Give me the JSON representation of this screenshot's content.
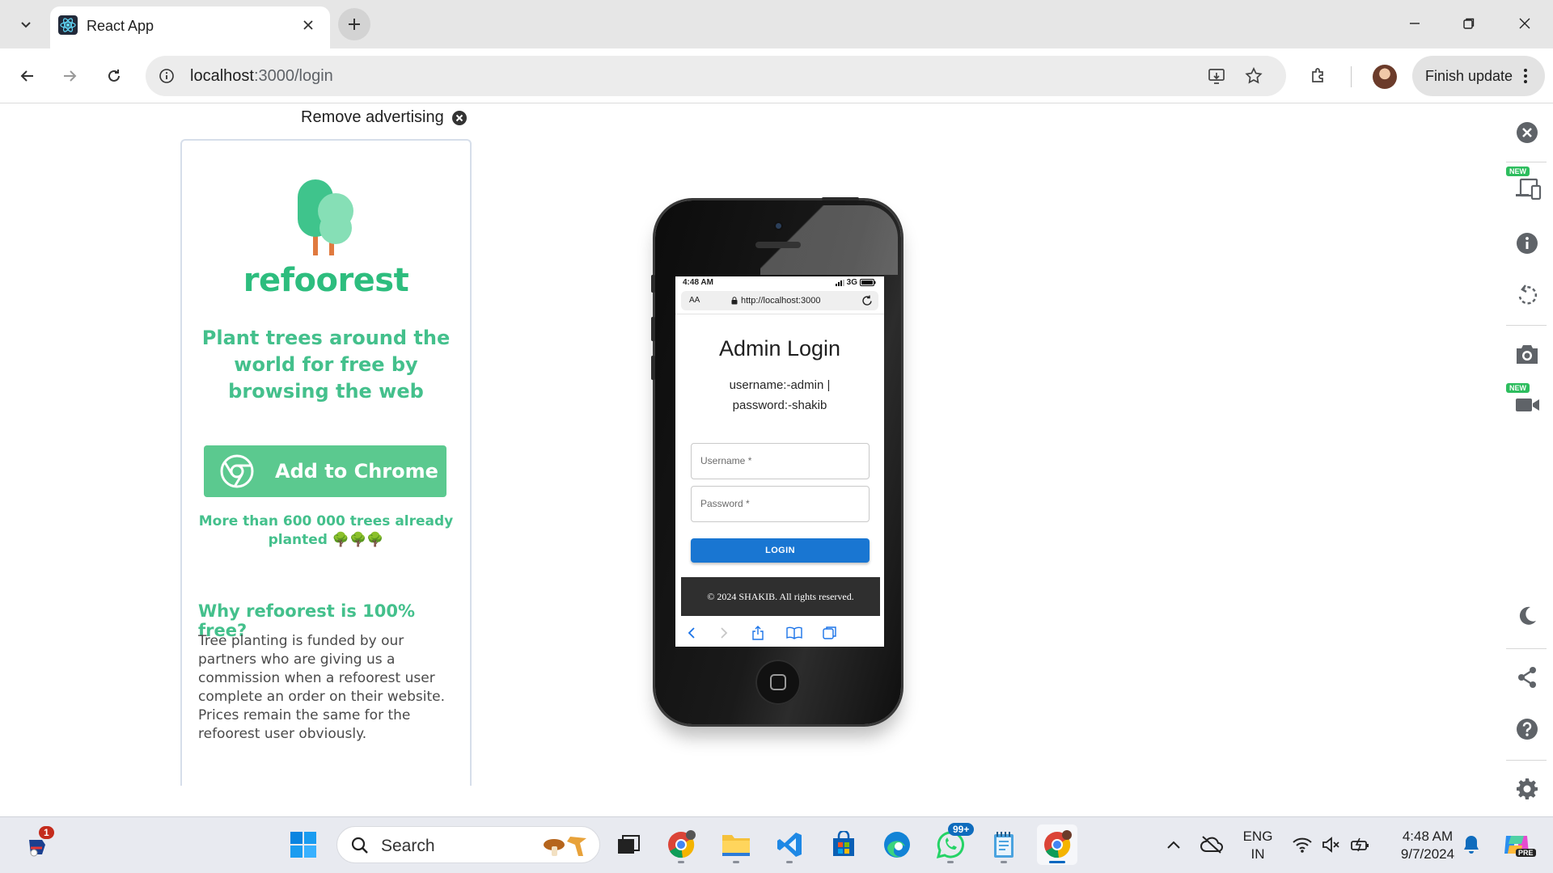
{
  "browser": {
    "tab_title": "React App",
    "url_host": "localhost",
    "url_path": ":3000/login",
    "finish_update_label": "Finish update"
  },
  "ad": {
    "remove_label": "Remove advertising",
    "brand": "refoorest",
    "headline": "Plant trees around the world for free by browsing the web",
    "cta_label": "Add to Chrome",
    "stat": "More than 600 000 trees already planted 🌳🌳🌳",
    "why_title": "Why refoorest is 100% free?",
    "why_body": "Tree planting is funded by our partners who are giving us a commission when a refoorest user complete an order on their website. Prices remain the same for the refoorest user obviously."
  },
  "phone": {
    "time": "4:48 AM",
    "network": "3G",
    "text_size": "AA",
    "url": "http://localhost:3000",
    "login": {
      "title": "Admin Login",
      "hint": "username:-admin | password:-shakib",
      "username_label": "Username *",
      "password_label": "Password *",
      "button_label": "LOGIN"
    },
    "footer_text": "© 2024 SHAKIB. All rights reserved."
  },
  "sidebar": {
    "new_badge": "NEW"
  },
  "taskbar": {
    "search_placeholder": "Search",
    "notification_count": "1",
    "whatsapp_badge": "99+",
    "language_line1": "ENG",
    "language_line2": "IN",
    "clock_time": "4:48 AM",
    "clock_date": "9/7/2024",
    "copilot_label": "PRE"
  },
  "colors": {
    "brand_green": "#2dbd7e",
    "login_blue": "#1976d2",
    "footer_dark": "#2f2f2f"
  }
}
